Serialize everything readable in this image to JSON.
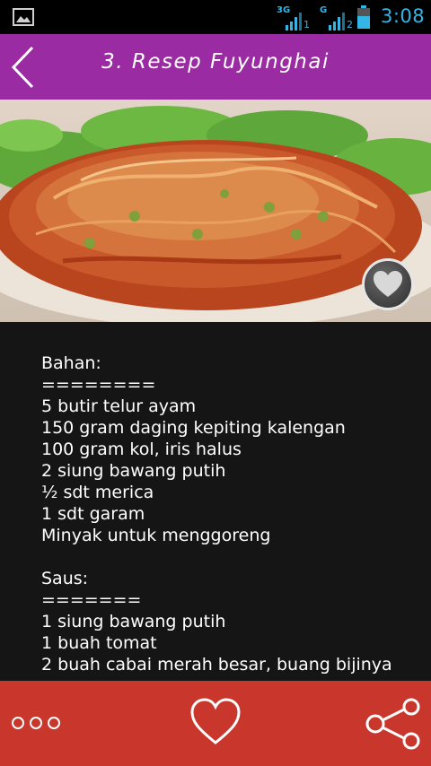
{
  "status_bar": {
    "network_1": "3G",
    "network_2": "G",
    "sim_1": "1",
    "sim_2": "2",
    "time": "3:08",
    "accent_color": "#33b5e5"
  },
  "header": {
    "title": "3. Resep Fuyunghai",
    "background": "#9b2ba2"
  },
  "recipe": {
    "image": "fuyunghai-dish",
    "text": "Bahan:\n========\n5 butir telur ayam\n150 gram daging kepiting kalengan\n100 gram kol, iris halus\n2 siung bawang putih\n½ sdt merica\n1 sdt garam\nMinyak untuk menggoreng\n\nSaus:\n=======\n1 siung bawang putih\n1 buah tomat\n2 buah cabai merah besar, buang bijinya"
  },
  "bottom_bar": {
    "background": "#c9372c",
    "icons": [
      "more-icon",
      "heart-icon",
      "share-icon"
    ]
  }
}
